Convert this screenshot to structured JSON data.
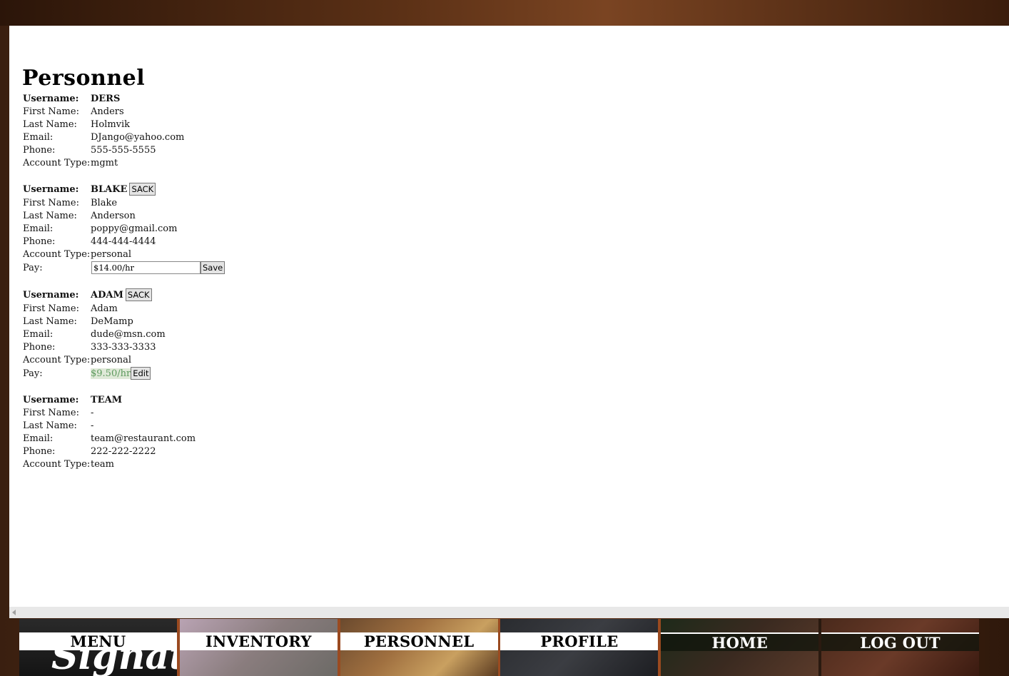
{
  "page": {
    "title": "Personnel"
  },
  "labels": {
    "username": "Username:",
    "first_name": "First Name:",
    "last_name": "Last Name:",
    "email": "Email:",
    "phone": "Phone:",
    "account_type": "Account Type:",
    "pay": "Pay:"
  },
  "personnel": [
    {
      "username": "DERS",
      "first_name": "Anders",
      "last_name": "Holmvik",
      "email": "DJango@yahoo.com",
      "phone": "555-555-5555",
      "account_type": "mgmt"
    },
    {
      "username": "BLAKE",
      "sack_label": "SACK",
      "first_name": "Blake",
      "last_name": "Anderson",
      "email": "poppy@gmail.com",
      "phone": "444-444-4444",
      "account_type": "personal",
      "pay_input_value": "$14.00/hr",
      "save_label": "Save"
    },
    {
      "username": "ADAM",
      "sack_label": "SACK",
      "first_name": "Adam",
      "last_name": "DeMamp",
      "email": "dude@msn.com",
      "phone": "333-333-3333",
      "account_type": "personal",
      "pay": "$9.50/hr",
      "edit_label": "Edit"
    },
    {
      "username": "TEAM",
      "first_name": "-",
      "last_name": "-",
      "email": "team@restaurant.com",
      "phone": "222-222-2222",
      "account_type": "team"
    }
  ],
  "nav": {
    "menu": "MENU",
    "inventory": "INVENTORY",
    "personnel": "PERSONNEL",
    "profile": "PROFILE",
    "home": "HOME",
    "logout": "LOG OUT",
    "menu_tile_script": "Signatu"
  }
}
